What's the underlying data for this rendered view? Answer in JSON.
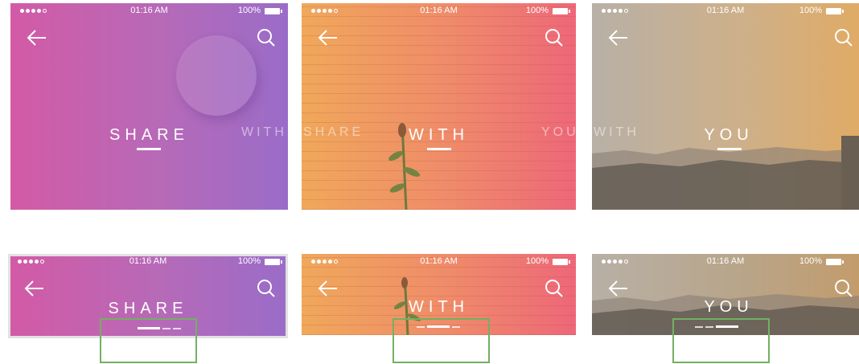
{
  "status": {
    "time": "01:16 AM",
    "battery": "100%"
  },
  "screens": {
    "share": {
      "title": "SHARE"
    },
    "with": {
      "title": "WITH"
    },
    "you": {
      "title": "YOU"
    }
  },
  "ghost_labels": {
    "with_left": "WITH",
    "share_right": "SHARE",
    "you_left": "YOU",
    "with_right": "WITH"
  },
  "colors": {
    "share": [
      "#d35aa6",
      "#9a6cc8"
    ],
    "with": [
      "#f0a85a",
      "#ee6779"
    ],
    "you": [
      "#b7aea0",
      "#e0ab66"
    ],
    "highlight": "#73b062"
  },
  "page_indicator": {
    "count": 3,
    "active": [
      0,
      1,
      2
    ]
  }
}
